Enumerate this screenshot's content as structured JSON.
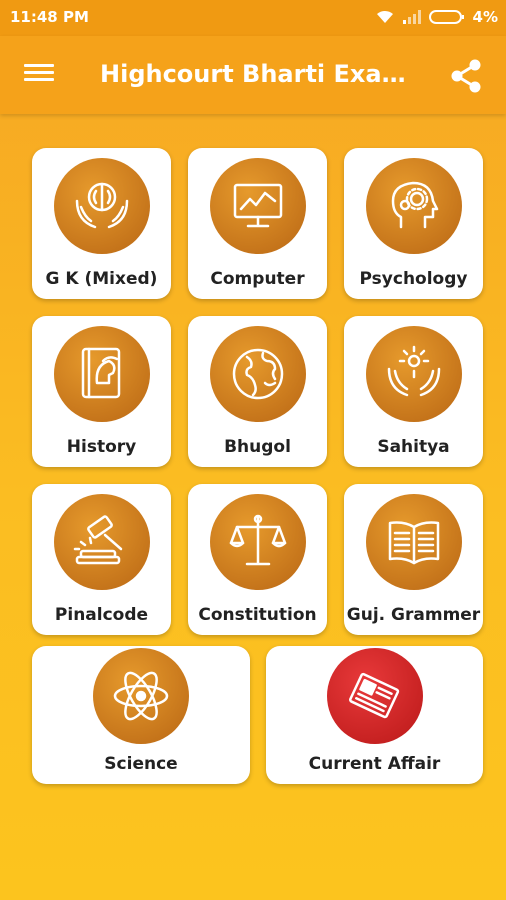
{
  "status_bar": {
    "time": "11:48 PM",
    "battery": "4%"
  },
  "app_bar": {
    "title": "Highcourt Bharti Exam..."
  },
  "categories": [
    {
      "label": "G K (Mixed)",
      "icon": "brain-hands-icon"
    },
    {
      "label": "Computer",
      "icon": "monitor-chart-icon"
    },
    {
      "label": "Psychology",
      "icon": "head-gears-icon"
    },
    {
      "label": "History",
      "icon": "history-book-icon"
    },
    {
      "label": "Bhugol",
      "icon": "globe-icon"
    },
    {
      "label": "Sahitya",
      "icon": "hands-flower-icon"
    },
    {
      "label": "Pinalcode",
      "icon": "gavel-icon"
    },
    {
      "label": "Constitution",
      "icon": "scales-icon"
    },
    {
      "label": "Guj. Grammer",
      "icon": "open-book-icon"
    },
    {
      "label": "Science",
      "icon": "atom-icon"
    },
    {
      "label": "Current Affair",
      "icon": "newspaper-icon"
    }
  ],
  "colors": {
    "app_bar": "#f5a21a",
    "icon_orange": "#c4731a",
    "icon_red": "#c31f1f"
  }
}
